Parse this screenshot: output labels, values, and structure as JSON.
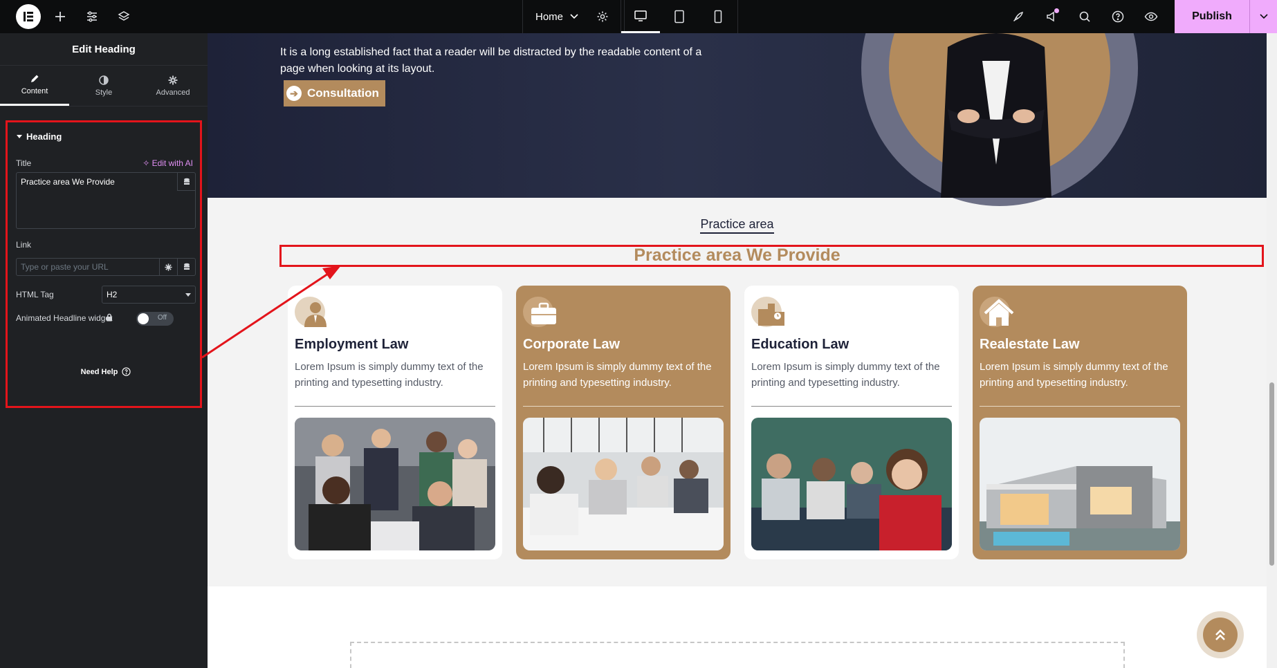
{
  "topbar": {
    "page_name": "Home",
    "publish_label": "Publish"
  },
  "panel": {
    "title": "Edit Heading",
    "tabs": [
      {
        "label": "Content"
      },
      {
        "label": "Style"
      },
      {
        "label": "Advanced"
      }
    ],
    "section_title": "Heading",
    "title_label": "Title",
    "ai_link": "Edit with AI",
    "title_value": "Practice area We Provide",
    "link_label": "Link",
    "link_placeholder": "Type or paste your URL",
    "html_tag_label": "HTML Tag",
    "html_tag_value": "H2",
    "animated_label": "Animated Headline widget",
    "toggle_state": "Off",
    "help_label": "Need Help"
  },
  "canvas": {
    "hero_text": "It is a long established fact that a reader will be distracted by the readable content of a page when looking at its layout.",
    "consult_label": "Consultation",
    "section_subtitle": "Practice area",
    "section_heading": "Practice area We Provide",
    "cards": [
      {
        "title": "Employment Law",
        "desc": "Lorem Ipsum is simply dummy text of the printing and typesetting industry.",
        "icon": "employee-icon"
      },
      {
        "title": "Corporate Law",
        "desc": "Lorem Ipsum is simply dummy text of the printing and typesetting industry.",
        "icon": "briefcase-icon"
      },
      {
        "title": "Education Law",
        "desc": "Lorem Ipsum is simply dummy text of the printing and typesetting industry.",
        "icon": "school-icon"
      },
      {
        "title": "Realestate Law",
        "desc": "Lorem Ipsum is simply dummy text of the printing and typesetting industry.",
        "icon": "house-icon"
      }
    ]
  },
  "colors": {
    "accent_brown": "#b38b5d",
    "navy": "#1e2238",
    "publish_pink": "#f0abfc",
    "highlight_red": "#e3141b"
  }
}
